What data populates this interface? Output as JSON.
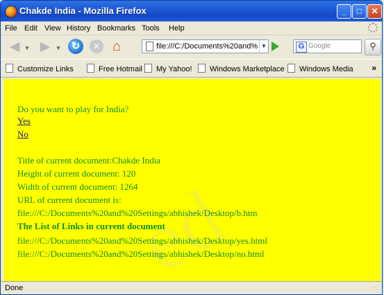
{
  "window": {
    "title": "Chakde India - Mozilla Firefox",
    "controls": {
      "minimize": "_",
      "maximize": "□",
      "close": "✕"
    }
  },
  "menu": [
    "File",
    "Edit",
    "View",
    "History",
    "Bookmarks",
    "Tools",
    "Help"
  ],
  "navbar": {
    "url": "file:///C:/Documents%20and%",
    "search_placeholder": "Google"
  },
  "bookmarks": [
    "Customize Links",
    "Free Hotmail",
    "My Yahoo!",
    "Windows Marketplace",
    "Windows Media"
  ],
  "bookmarks_overflow": "»",
  "content": {
    "question": "Do you want to play for India?",
    "links": [
      "Yes",
      "No"
    ],
    "title_line": "Title of current document:Chakde India",
    "height_line": "Height of current document: 120",
    "width_line": "Width of current document: 1264",
    "url_label": "URL of current document is:",
    "url_value": "file:///C:/Documents%20and%20Settings/abhishek/Desktop/b.htm",
    "links_heading": "The List of Links in current document",
    "link_list": [
      "file:///C:/Documents%20and%20Settings/abhishek/Desktop/yes.html",
      "file:///C:/Documents%20and%20Settings/abhishek/Desktop/no.html"
    ],
    "bg_color": "#ffff00",
    "text_color": "#0f8f24"
  },
  "status": {
    "text": "Done"
  }
}
